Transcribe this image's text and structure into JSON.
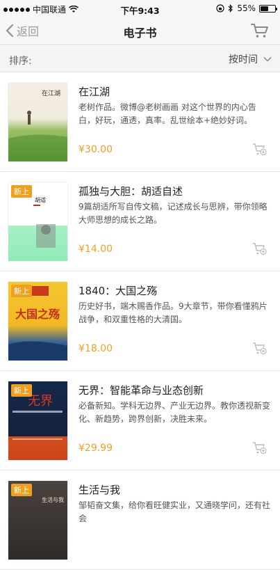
{
  "status": {
    "carrier": "中国联通",
    "time": "下午9:43",
    "battery": "55%",
    "battery_level": 0.55
  },
  "nav": {
    "back_label": "返回",
    "title": "电子书"
  },
  "sort": {
    "label": "排序:",
    "value": "按时间"
  },
  "colors": {
    "accent": "#f0a021",
    "background": "#f4f4f4"
  },
  "books": [
    {
      "title": "在江湖",
      "desc": "老树作品。微博@老树画画 对这个世界的内心告白，好玩，通透，真率。乱世绘本+绝妙好词。",
      "price": "¥30.00",
      "badge": "",
      "cover_text": "在江湖"
    },
    {
      "title": "孤独与大胆：胡适自述",
      "desc": "9篇胡适所写自传文稿，记述成长与思辨，带你领略大师思想的成长之路。",
      "price": "¥14.00",
      "badge": "新上",
      "cover_text": "胡适"
    },
    {
      "title": "1840：大国之殇",
      "desc": "历史好书，端木赐香作品。9大章节，带你看懂鸦片战争，和双重性格的大清国。",
      "price": "¥18.00",
      "badge": "新上",
      "cover_text": "大国之殇"
    },
    {
      "title": "无界：智能革命与业态创新",
      "desc": "必备新知。学科无边界、产业无边界。教你透视新变化、新趋势，跨界创新，决胜未来。",
      "price": "¥29.99",
      "badge": "新上",
      "cover_text": "无界"
    },
    {
      "title": "生活与我",
      "desc": "邹韬奋文集，给你看旺健实业，又通晓学问，还有社会",
      "price": "",
      "badge": "新上",
      "cover_text": "生活与我"
    }
  ]
}
